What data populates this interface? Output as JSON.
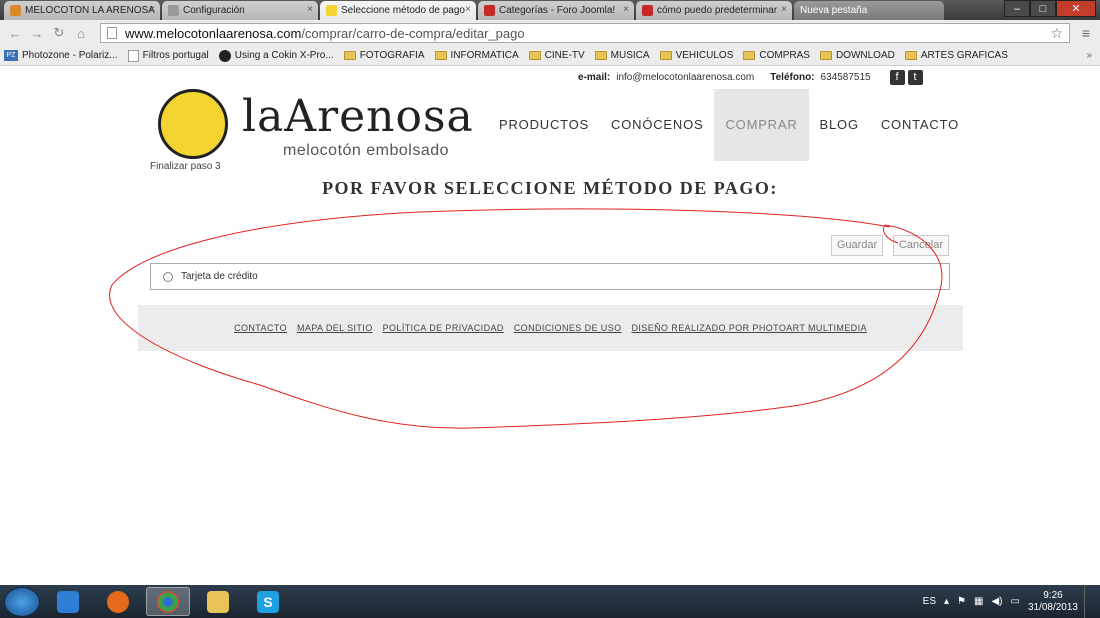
{
  "browser": {
    "tabs": [
      {
        "title": "MELOCOTON LA ARENOSA",
        "color": "#d88a2a"
      },
      {
        "title": "Configuración",
        "color": "#999999"
      },
      {
        "title": "Seleccione método de pago",
        "color": "#f4d430"
      },
      {
        "title": "Categorías - Foro Joomla!",
        "color": "#c62828"
      },
      {
        "title": "cómo puedo predeterminar",
        "color": "#c62828"
      },
      {
        "title": "Nueva pestaña",
        "color": ""
      }
    ],
    "url_host": "www.melocotonlaarenosa.com",
    "url_path": "/comprar/carro-de-compra/editar_pago",
    "bookmarks": [
      {
        "label": "Photozone - Polariz...",
        "icon": "pz-icon"
      },
      {
        "label": "Filtros portugal",
        "icon": "page-icon"
      },
      {
        "label": "Using a Cokin X-Pro...",
        "icon": "camera-icon"
      },
      {
        "label": "FOTOGRAFIA",
        "icon": "folder-icon"
      },
      {
        "label": "INFORMATICA",
        "icon": "folder-icon"
      },
      {
        "label": "CINE-TV",
        "icon": "folder-icon"
      },
      {
        "label": "MUSICA",
        "icon": "folder-icon"
      },
      {
        "label": "VEHICULOS",
        "icon": "folder-icon"
      },
      {
        "label": "COMPRAS",
        "icon": "folder-icon"
      },
      {
        "label": "DOWNLOAD",
        "icon": "folder-icon"
      },
      {
        "label": "ARTES GRAFICAS",
        "icon": "folder-icon"
      }
    ],
    "bookmarks_more": "»"
  },
  "site": {
    "contact": {
      "email_label": "e-mail:",
      "email": "info@melocotonlaarenosa.com",
      "phone_label": "Teléfono:",
      "phone": "634587515"
    },
    "social": {
      "facebook": "f",
      "twitter": "t"
    },
    "brand": "laArenosa",
    "tagline": "melocotón embolsado",
    "step": "Finalizar paso 3",
    "menu": [
      "PRODUCTOS",
      "CONÓCENOS",
      "COMPRAR",
      "BLOG",
      "CONTACTO"
    ],
    "menu_active": "COMPRAR",
    "heading": "POR FAVOR SELECCIONE MÉTODO DE PAGO:",
    "buttons": {
      "save": "Guardar",
      "cancel": "Cancelar"
    },
    "payment_options": [
      "Tarjeta de crédito"
    ],
    "footer_links": [
      "CONTACTO",
      "MAPA DEL SITIO",
      "POLÍTICA DE PRIVACIDAD",
      "CONDICIONES DE USO",
      "DISEÑO REALIZADO POR PHOTOART MULTIMEDIA"
    ]
  },
  "taskbar": {
    "apps": [
      {
        "icon": "media-player-icon",
        "color": "#2d7fd6"
      },
      {
        "icon": "firefox-icon",
        "color": "#e66a1c"
      },
      {
        "icon": "chrome-icon",
        "color": "#3aa14a"
      },
      {
        "icon": "explorer-icon",
        "color": "#e8c35a"
      },
      {
        "icon": "skype-icon",
        "color": "#1ea1e0"
      }
    ],
    "language": "ES",
    "time": "9:26",
    "date": "31/08/2013"
  },
  "colors": {
    "accent_yellow": "#f4d430",
    "annotation_red": "#e02020"
  }
}
